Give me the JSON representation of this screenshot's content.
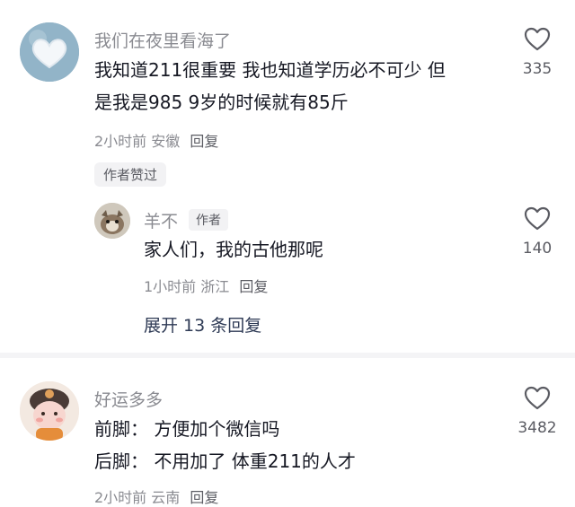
{
  "comments": [
    {
      "username": "我们在夜里看海了",
      "lines": [
        "我知道211很重要 我也知道学历必不可少 但",
        "是我是985 9岁的时候就有85斤"
      ],
      "time": "2小时前",
      "location": "安徽",
      "reply_label": "回复",
      "likes": "335",
      "tag": "作者赞过",
      "avatar_icon": "heart-sticker-icon",
      "reply": {
        "username": "羊不",
        "badge": "作者",
        "text": "家人们，我的古他那呢",
        "time": "1小时前",
        "location": "浙江",
        "reply_label": "回复",
        "likes": "140",
        "avatar_icon": "animal-photo-icon"
      },
      "expand_label": "展开 13 条回复"
    },
    {
      "username": "好运多多",
      "lines": [
        "前脚：  方便加个微信吗",
        "后脚：  不用加了  体重211的人才"
      ],
      "time": "2小时前",
      "location": "云南",
      "reply_label": "回复",
      "likes": "3482",
      "avatar_icon": "cartoon-character-icon"
    }
  ],
  "colors": {
    "text": "#161823",
    "secondary": "#8a8b91",
    "expand": "#2e3a55",
    "tag_bg": "#f2f2f4"
  }
}
